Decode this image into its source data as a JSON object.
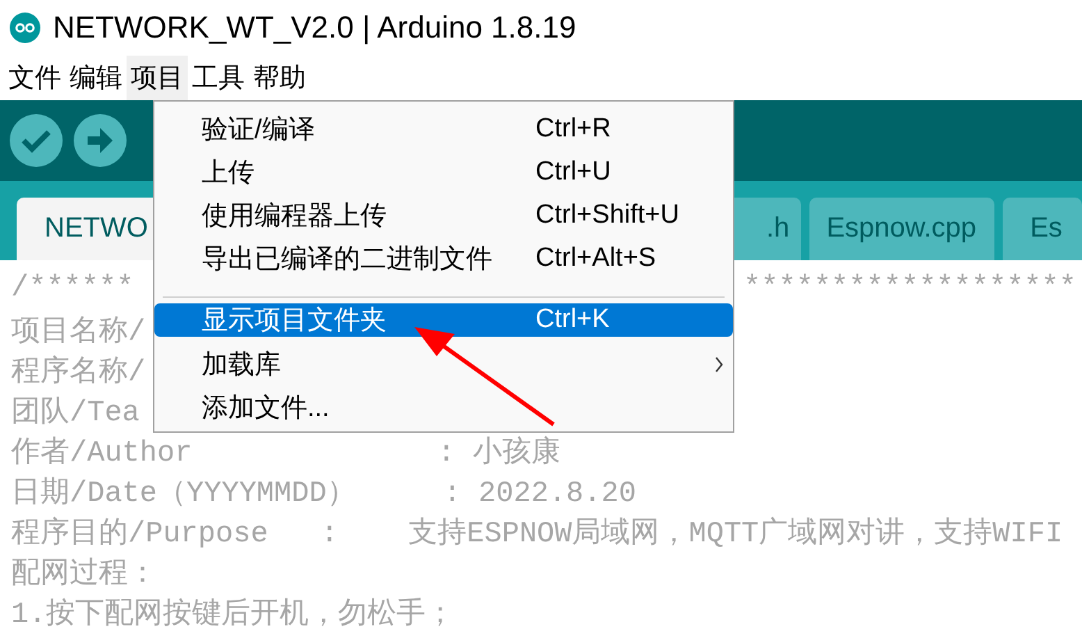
{
  "window": {
    "title": "NETWORK_WT_V2.0 | Arduino 1.8.19"
  },
  "menubar": [
    {
      "label": "文件",
      "selected": false
    },
    {
      "label": "编辑",
      "selected": false
    },
    {
      "label": "项目",
      "selected": true
    },
    {
      "label": "工具",
      "selected": false
    },
    {
      "label": "帮助",
      "selected": false
    }
  ],
  "tabs": [
    {
      "label": "NETWO",
      "selected": true
    },
    {
      "label": ".h",
      "selected": false
    },
    {
      "label": "Espnow.cpp",
      "selected": false
    },
    {
      "label": "Es",
      "selected": false
    }
  ],
  "menu": [
    {
      "kind": "item",
      "label": "验证/编译",
      "shortcut": "Ctrl+R",
      "selected": false
    },
    {
      "kind": "item",
      "label": "上传",
      "shortcut": "Ctrl+U",
      "selected": false
    },
    {
      "kind": "item",
      "label": "使用编程器上传",
      "shortcut": "Ctrl+Shift+U",
      "selected": false
    },
    {
      "kind": "item",
      "label": "导出已编译的二进制文件",
      "shortcut": "Ctrl+Alt+S",
      "selected": false
    },
    {
      "kind": "separator"
    },
    {
      "kind": "item",
      "label": "显示项目文件夹",
      "shortcut": "Ctrl+K",
      "selected": true
    },
    {
      "kind": "submenu",
      "label": "加载库",
      "selected": false
    },
    {
      "kind": "item",
      "label": "添加文件...",
      "selected": false
    }
  ],
  "code": [
    {
      "left": "/******",
      "right": "*******************"
    },
    {
      "left": "项目名称/"
    },
    {
      "left": "程序名称/"
    },
    {
      "left": "团队/Tea"
    },
    {
      "left": "作者/Author              : 小孩康"
    },
    {
      "left": "日期/Date（YYYYMMDD）     : 2022.8.20"
    },
    {
      "left": "程序目的/Purpose   :    支持ESPNOW局域网，MQTT广域网对讲，支持WIFI"
    },
    {
      "left": "配网过程："
    },
    {
      "left": "1.按下配网按键后开机，勿松手；"
    }
  ]
}
